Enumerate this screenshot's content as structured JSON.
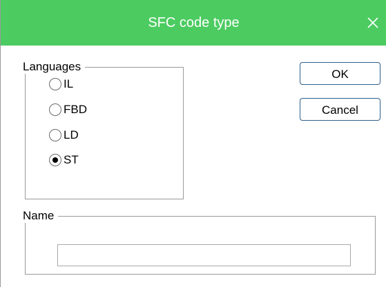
{
  "dialog": {
    "title": "SFC code type",
    "title_bar_color": "#4ccb61",
    "close_icon": "close-icon"
  },
  "languages_group": {
    "label": "Languages",
    "options": [
      {
        "label": "IL",
        "checked": false
      },
      {
        "label": "FBD",
        "checked": false
      },
      {
        "label": "LD",
        "checked": false
      },
      {
        "label": "ST",
        "checked": true
      }
    ]
  },
  "buttons": {
    "ok_label": "OK",
    "cancel_label": "Cancel"
  },
  "name_group": {
    "label": "Name",
    "input_value": "",
    "input_placeholder": ""
  }
}
